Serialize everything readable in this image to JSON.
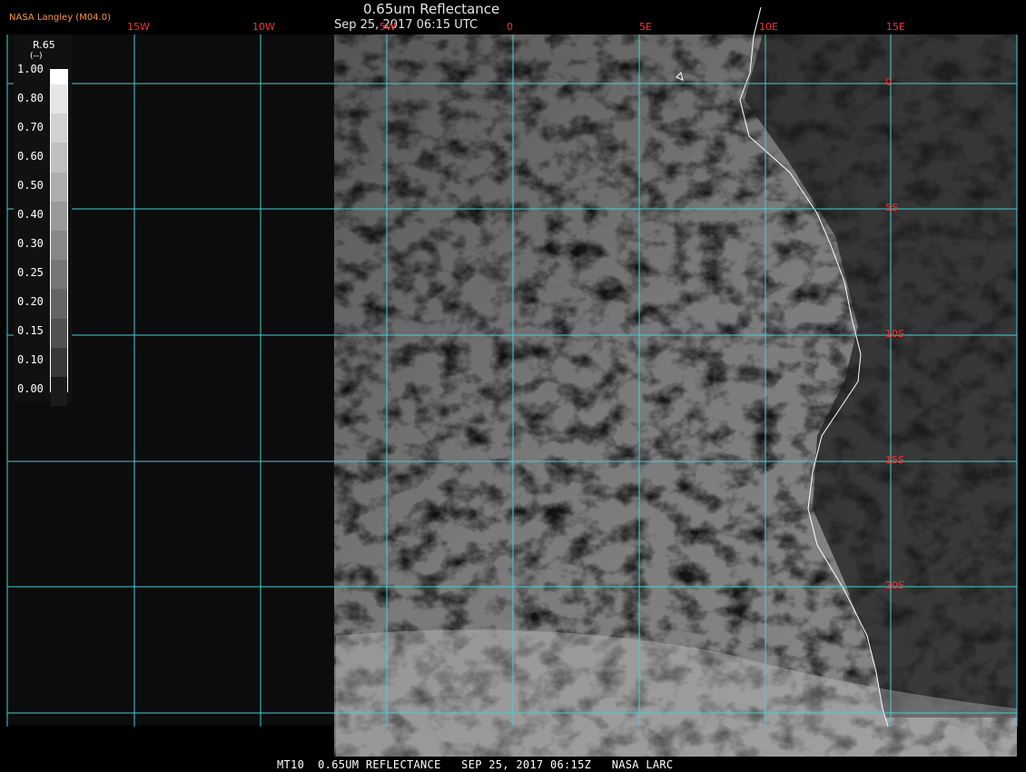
{
  "header": {
    "credit": "NASA Langley (M04.0)",
    "title": "0.65um Reflectance",
    "subtitle": "Sep 25, 2017 06:15 UTC"
  },
  "legend": {
    "title": "R.65",
    "unit": "(--)",
    "ticks": [
      "1.00",
      "0.80",
      "0.70",
      "0.60",
      "0.50",
      "0.40",
      "0.30",
      "0.25",
      "0.20",
      "0.15",
      "0.10",
      "0.00"
    ],
    "colors": [
      "#ffffff",
      "#e6e6e6",
      "#d2d2d2",
      "#c0c0c0",
      "#adadad",
      "#9a9a9a",
      "#888888",
      "#767676",
      "#646464",
      "#505050",
      "#383838",
      "#1a1a1a"
    ]
  },
  "longitude_labels": [
    "15W",
    "10W",
    "5W",
    "0",
    "5E",
    "10E",
    "15E"
  ],
  "latitude_labels": [
    "0",
    "5S",
    "10S",
    "15S",
    "20S"
  ],
  "grid_color": "#3fd0d6",
  "label_color": "#ff3030",
  "footer": "MT10  0.65UM REFLECTANCE   SEP 25, 2017 06:15Z   NASA LARC"
}
